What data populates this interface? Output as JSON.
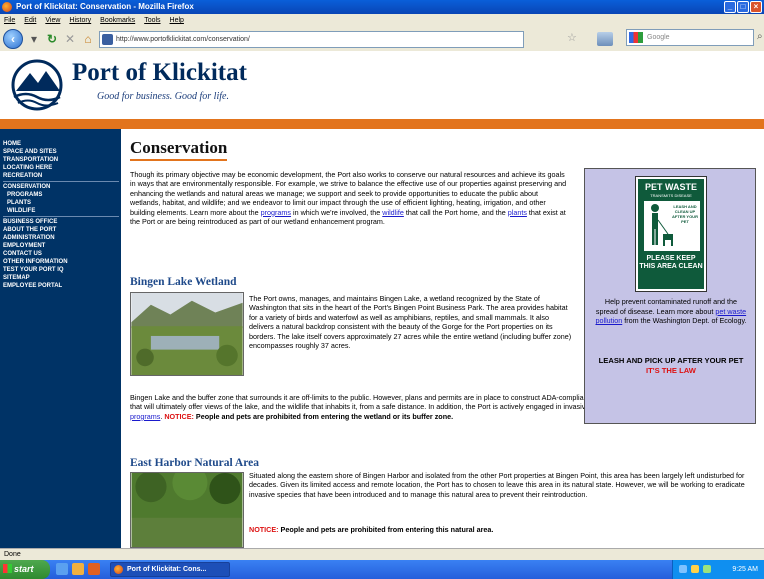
{
  "window": {
    "title": "Port of Klickitat: Conservation - Mozilla Firefox",
    "controls": [
      "_",
      "□",
      "×"
    ]
  },
  "menubar": [
    "File",
    "Edit",
    "View",
    "History",
    "Bookmarks",
    "Tools",
    "Help"
  ],
  "toolbar": {
    "url": "http://www.portofklickitat.com/conservation/",
    "search_placeholder": "Google"
  },
  "site": {
    "name": "Port of Klickitat",
    "tagline": "Good for business. Good for life."
  },
  "sidebar": {
    "groups": [
      [
        {
          "label": "Home",
          "sub": false
        },
        {
          "label": "Space and Sites",
          "sub": false
        },
        {
          "label": "Transportation",
          "sub": false
        },
        {
          "label": "Locating Here",
          "sub": false
        },
        {
          "label": "Recreation",
          "sub": false
        }
      ],
      [
        {
          "label": "Conservation",
          "sub": false
        },
        {
          "label": "Programs",
          "sub": true
        },
        {
          "label": "Plants",
          "sub": true
        },
        {
          "label": "Wildlife",
          "sub": true
        }
      ],
      [
        {
          "label": "Business Office",
          "sub": false
        },
        {
          "label": "About the Port",
          "sub": false
        },
        {
          "label": "Administration",
          "sub": false
        },
        {
          "label": "Employment",
          "sub": false
        },
        {
          "label": "Contact Us",
          "sub": false
        },
        {
          "label": "Other Information",
          "sub": false
        },
        {
          "label": "Test Your Port IQ",
          "sub": false
        },
        {
          "label": "Sitemap",
          "sub": false
        },
        {
          "label": "Employee Portal",
          "sub": false
        }
      ]
    ]
  },
  "main": {
    "title": "Conservation",
    "intro": {
      "part1": "Though its primary objective may be economic development, the Port also works to conserve our natural resources and achieve its goals in ways that are environmentally responsible. For example, we strive to balance the effective use of our properties against preserving and enhancing the wetlands and natural areas we manage; we support and seek to provide opportunities to educate the public about wetlands, habitat, and wildlife; and we endeavor to limit our impact through the use of efficient lighting, heating, irrigation, and other building elements. Learn more about the ",
      "link1": "programs",
      "part2": " in which we're involved, the ",
      "link2": "wildlife",
      "part3": " that call the Port home, and the ",
      "link3": "plants",
      "part4": " that exist at the Port or are being reintroduced as part of our wetland enhancement program."
    },
    "bingen": {
      "heading": "Bingen Lake Wetland",
      "para1": "The Port owns, manages, and maintains Bingen Lake, a wetland recognized by the State of Washington that sits in the heart of the Port's Bingen Point Business Park. The area provides habitat for a variety of birds and waterfowl as well as amphibians, reptiles, and small mammals. It also delivers a natural backdrop consistent with the beauty of the Gorge for the Port properties on its borders. The lake itself covers approximately 27 acres while the entire wetland (including buffer zone) encompasses roughly 37 acres.",
      "para2": "Bingen Lake and the buffer zone that surrounds it are off-limits to the public. However, plans and permits are in place to construct ADA-compliant, multi-use paths and a viewing platform (or blind) that will ultimately offer views of the lake, and the wildlife that inhabits it, from a safe distance. In addition, the Port is actively engaged in invasive species eradication and native plant restoration ",
      "link": "programs",
      "notice_label": "NOTICE:",
      "notice_text": "People and pets are prohibited from entering the wetland or its buffer zone."
    },
    "eastharbor": {
      "heading": "East Harbor Natural Area",
      "para1": "Situated along the eastern shore of Bingen Harbor and isolated from the other Port properties at Bingen Point, this area has been largely left undisturbed for decades. Given its limited access and remote location, the Port has to chosen to leave this area in its natural state. However, we will be working to eradicate invasive species that have been introduced and to manage this natural area to prevent their reintroduction.",
      "notice_label": "NOTICE:",
      "notice_text": "People and pets are prohibited from entering this natural area."
    },
    "sidebox": {
      "sign_title": "PET WASTE",
      "sign_sub": "TRANSMITS DISEASE",
      "sign_panel": "LEASH AND CLEAN UP AFTER YOUR PET",
      "sign_bottom": "PLEASE KEEP THIS AREA CLEAN",
      "text1": "Help prevent contaminated runoff and the spread of disease. Learn more about ",
      "link": "pet waste pollution",
      "text2": " from the Washington Dept. of Ecology.",
      "bold": "LEASH AND PICK UP AFTER YOUR PET",
      "law": "IT'S THE LAW"
    }
  },
  "statusbar": {
    "text": "Done"
  },
  "taskbar": {
    "start": "start",
    "window_item": "Port of Klickitat: Cons...",
    "clock": "9:25 AM"
  },
  "colors": {
    "navy": "#003366",
    "orange": "#e2741d",
    "heading_blue": "#1f4a8a",
    "notice_red": "#dd1111",
    "sidebox_bg": "#c5c3e6",
    "sign_green": "#0f5a3b"
  }
}
